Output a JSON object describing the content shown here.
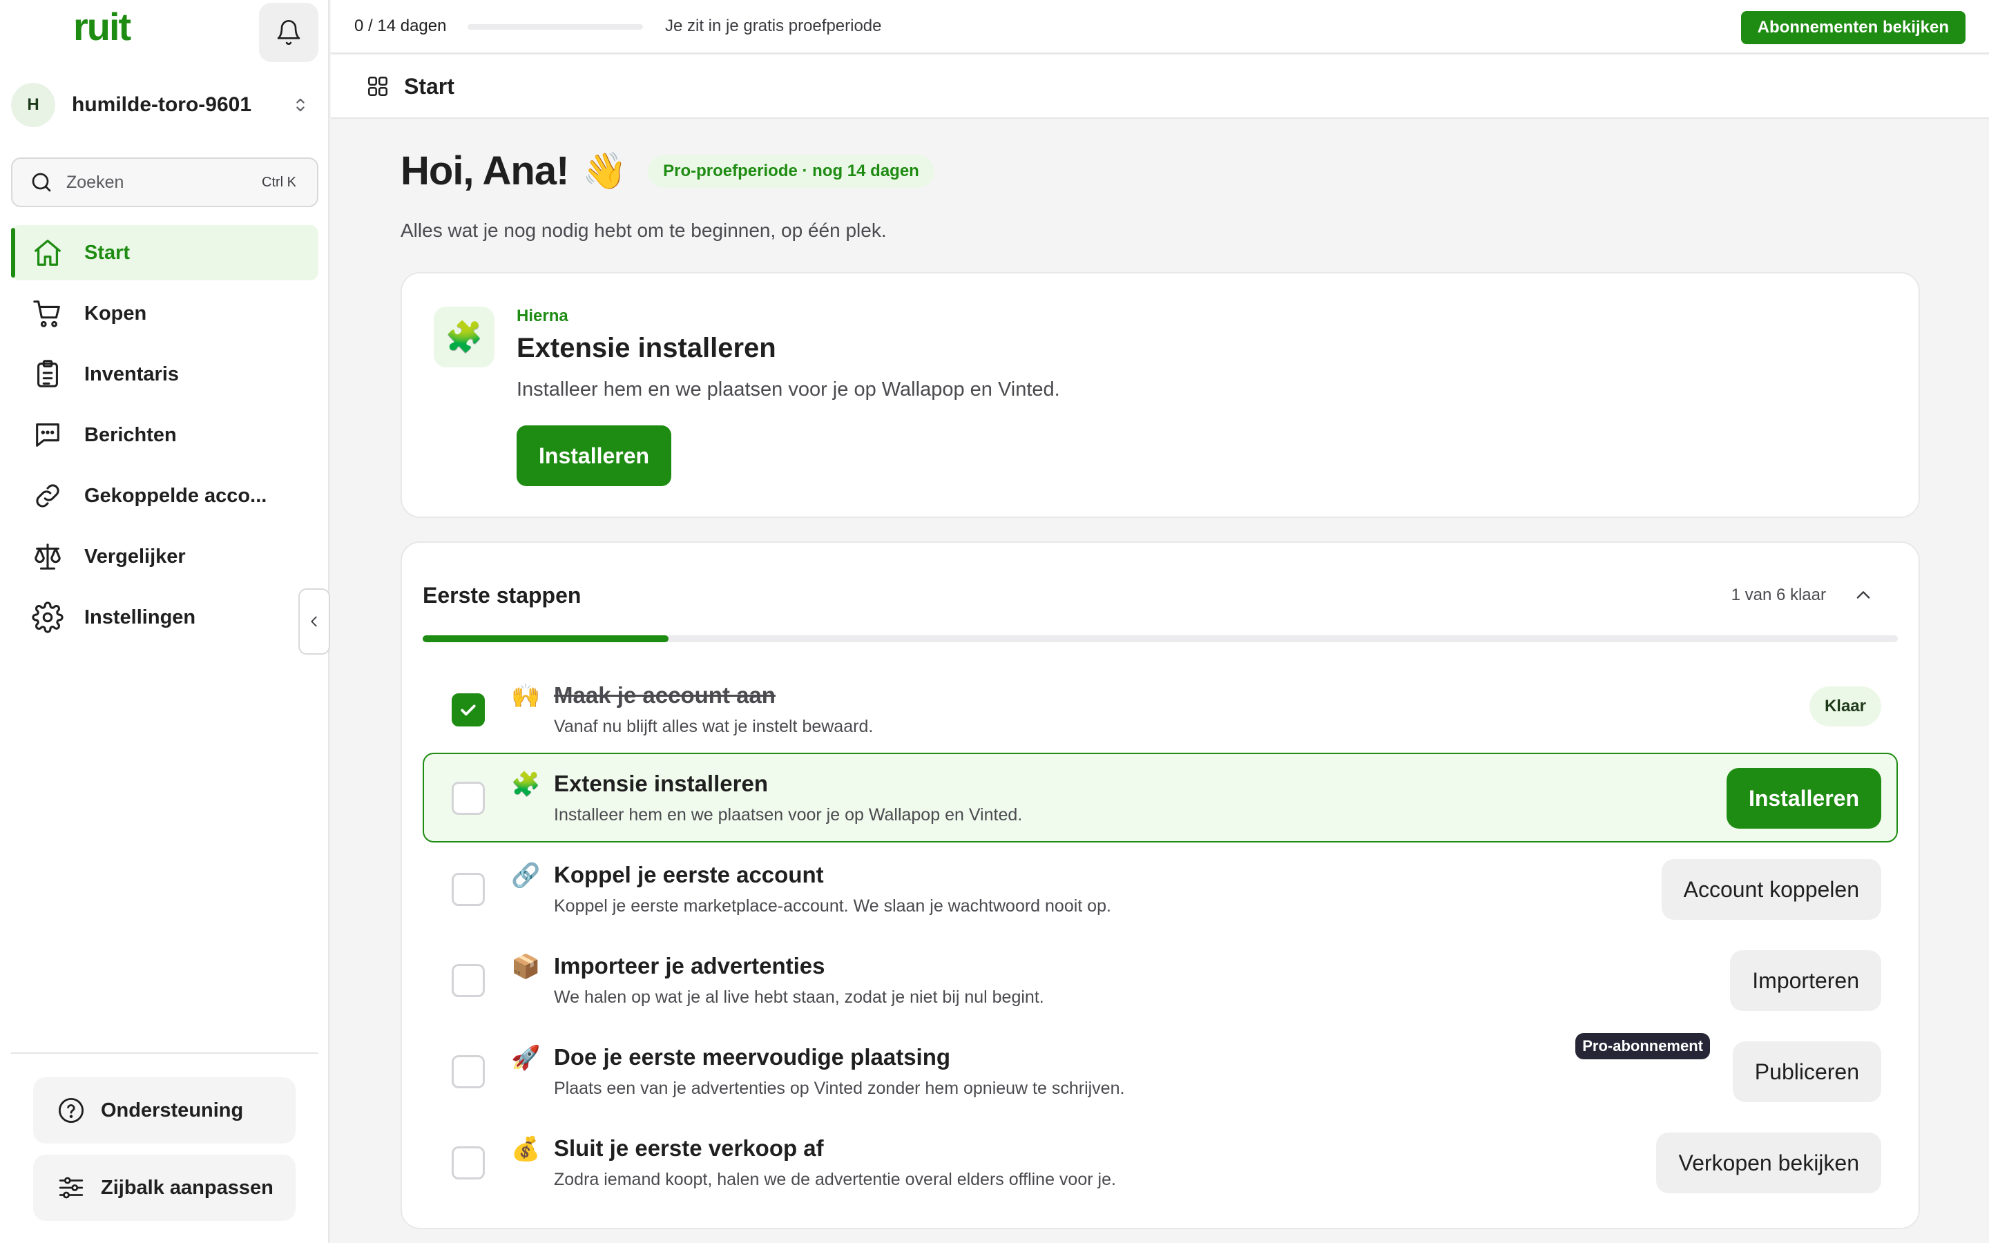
{
  "sidebar": {
    "logo": "ruit",
    "workspace": {
      "avatar_initial": "H",
      "name": "humilde-toro-9601"
    },
    "search": {
      "placeholder": "Zoeken",
      "shortcut": "Ctrl K"
    },
    "items": [
      {
        "label": "Start",
        "icon": "home-icon",
        "active": true
      },
      {
        "label": "Kopen",
        "icon": "cart-icon"
      },
      {
        "label": "Inventaris",
        "icon": "clipboard-icon"
      },
      {
        "label": "Berichten",
        "icon": "chat-icon"
      },
      {
        "label": "Gekoppelde acco...",
        "icon": "link-icon"
      },
      {
        "label": "Vergelijker",
        "icon": "scale-icon"
      },
      {
        "label": "Instellingen",
        "icon": "gear-icon"
      }
    ],
    "support_label": "Ondersteuning",
    "customize_label": "Zijbalk aanpassen"
  },
  "topbar": {
    "trial_count": "0 / 14 dagen",
    "trial_progress": 0,
    "trial_text": "Je zit in je gratis proefperiode",
    "subscriptions_button": "Abonnementen bekijken"
  },
  "page": {
    "title": "Start"
  },
  "greeting": {
    "title": "Hoi, Ana!",
    "emoji": "👋",
    "badge": "Pro-proefperiode · nog 14 dagen",
    "subtitle": "Alles wat je nog nodig hebt om te beginnen, op één plek."
  },
  "next_step": {
    "icon": "🧩",
    "kicker": "Hierna",
    "title": "Extensie installeren",
    "description": "Installeer hem en we plaatsen voor je op Wallapop en Vinted.",
    "button": "Installeren"
  },
  "steps": {
    "title": "Eerste stappen",
    "count_label": "1 van 6 klaar",
    "progress": 0.1667,
    "items": [
      {
        "emoji": "🙌",
        "title": "Maak je account aan",
        "description": "Vanaf nu blijft alles wat je instelt bewaard.",
        "done": true,
        "badge": "Klaar"
      },
      {
        "emoji": "🧩",
        "title": "Extensie installeren",
        "description": "Installeer hem en we plaatsen voor je op Wallapop en Vinted.",
        "button": "Installeren",
        "highlight": true
      },
      {
        "emoji": "🔗",
        "title": "Koppel je eerste account",
        "description": "Koppel je eerste marketplace-account. We slaan je wachtwoord nooit op.",
        "button": "Account koppelen"
      },
      {
        "emoji": "📦",
        "title": "Importeer je advertenties",
        "description": "We halen op wat je al live hebt staan, zodat je niet bij nul begint.",
        "button": "Importeren"
      },
      {
        "emoji": "🚀",
        "title": "Doe je eerste meervoudige plaatsing",
        "description": "Plaats een van je advertenties op Vinted zonder hem opnieuw te schrijven.",
        "button": "Publiceren",
        "tag": "Pro-abonnement"
      },
      {
        "emoji": "💰",
        "title": "Sluit je eerste verkoop af",
        "description": "Zodra iemand koopt, halen we de advertentie overal elders offline voor je.",
        "button": "Verkopen bekijken"
      }
    ]
  },
  "colors": {
    "brand": "#1e8c12",
    "brand_light": "#ecf8e7",
    "dark_badge": "#262636"
  }
}
